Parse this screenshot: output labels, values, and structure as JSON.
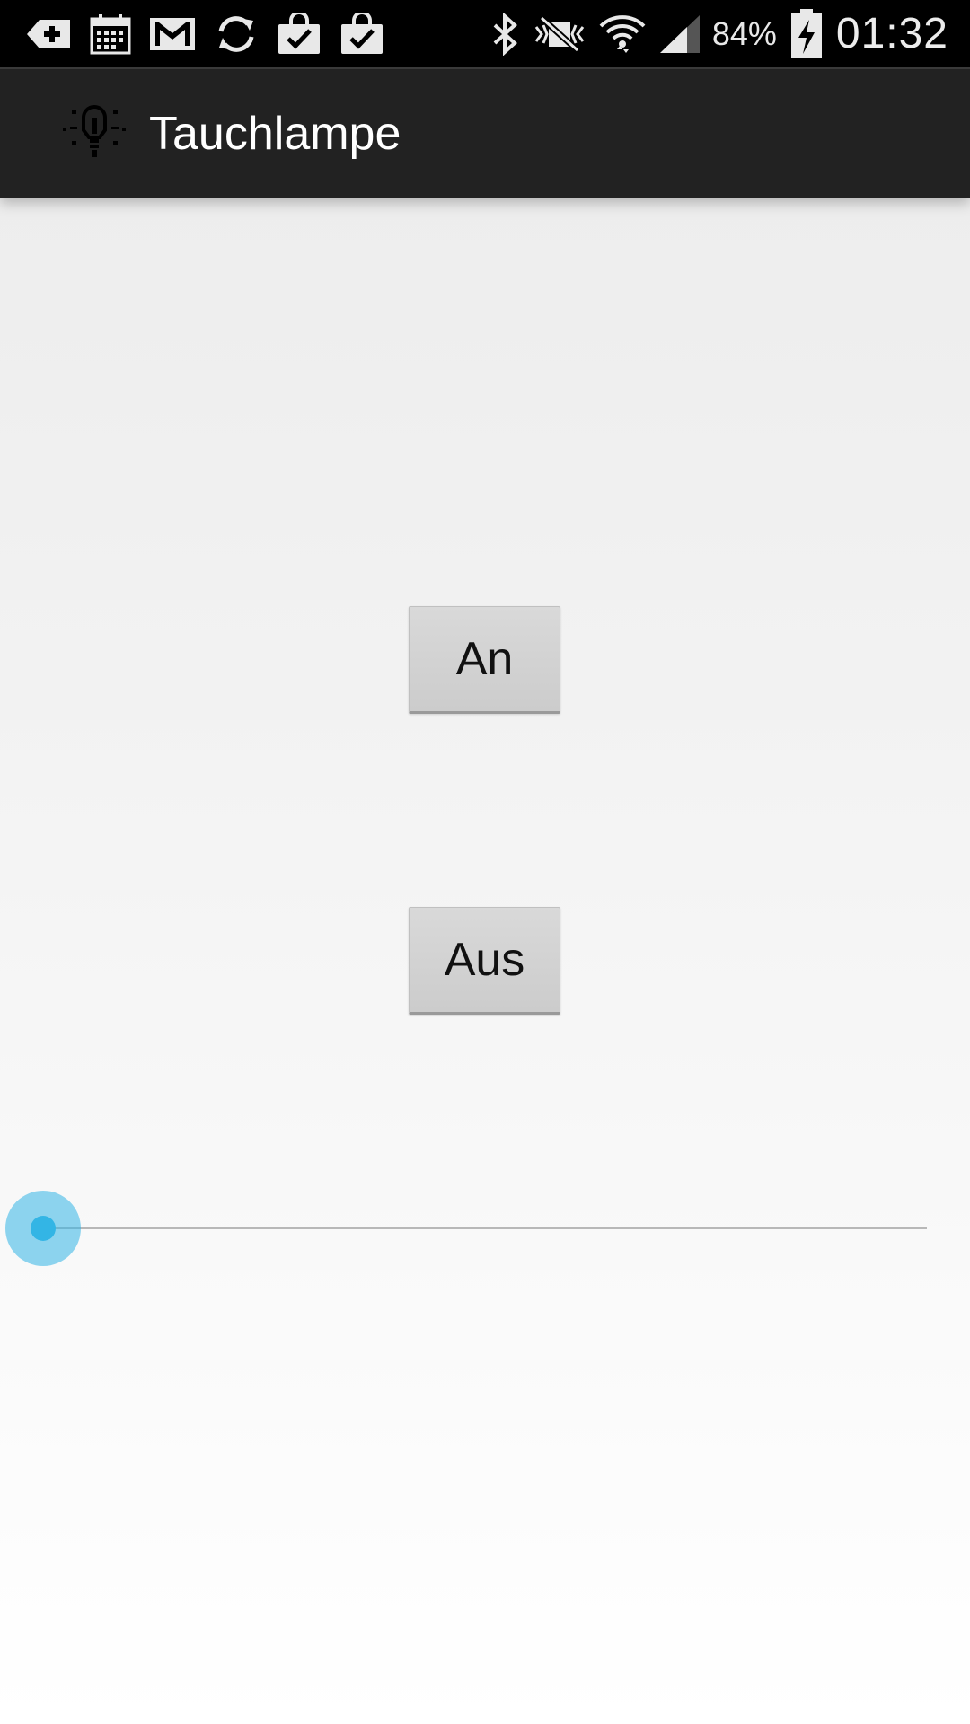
{
  "status_bar": {
    "left_icons": [
      "download-icon",
      "calendar-icon",
      "gmail-icon",
      "sync-icon",
      "shopping-bag-check-icon",
      "shopping-bag-check-icon"
    ],
    "right_icons": [
      "bluetooth-icon",
      "silent-mode-icon",
      "wifi-icon",
      "signal-icon"
    ],
    "battery_percent": "84%",
    "time": "01:32"
  },
  "action_bar": {
    "app_icon": "lightbulb-icon",
    "title": "Tauchlampe"
  },
  "main": {
    "on_button_label": "An",
    "off_button_label": "Aus",
    "brightness_slider": {
      "value": 0,
      "min": 0,
      "max": 100
    }
  },
  "colors": {
    "accent": "#33b5e5",
    "action_bar_bg": "#222222",
    "status_bar_bg": "#000000",
    "button_bg": "#d3d3d3"
  }
}
